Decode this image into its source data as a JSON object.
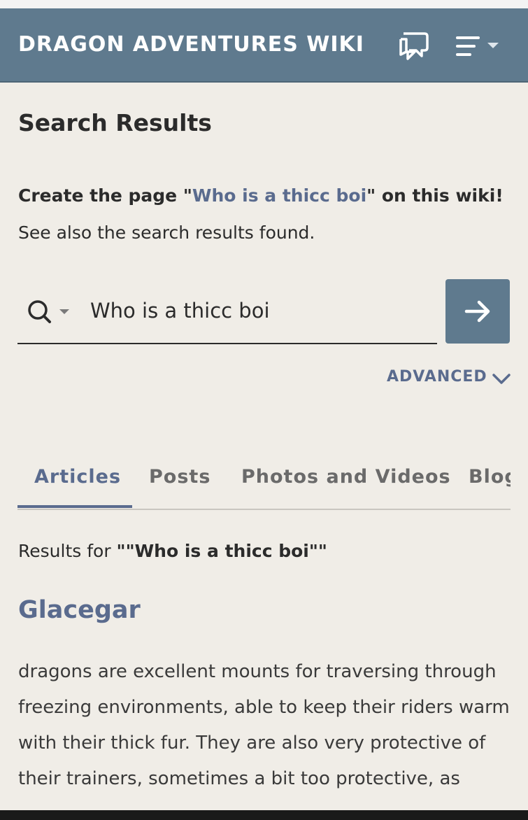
{
  "header": {
    "wiki_title": "DRAGON ADVENTURES WIKI",
    "discussions_icon": "speech-bubbles-icon",
    "menu_icon": "hamburger-menu-icon",
    "background_color": "#5f7a8e"
  },
  "main": {
    "page_title": "Search Results",
    "create_prefix": "Create the page \"",
    "create_link": "Who is a thicc boi",
    "create_suffix": "\" on this wiki!",
    "see_also": "See also the search results found."
  },
  "search": {
    "value": "Who is a thicc boi",
    "search_icon": "magnifier-icon",
    "go_icon": "arrow-right-icon",
    "advanced_label": "ADVANCED"
  },
  "tabs": [
    {
      "label": "Articles",
      "active": true
    },
    {
      "label": "Posts",
      "active": false
    },
    {
      "label": "Photos and Videos",
      "active": false
    },
    {
      "label": "Blogs",
      "active": false
    }
  ],
  "results": {
    "results_for_prefix": "Results for ",
    "results_for_query": "\"\"Who is a thicc boi\"\"",
    "items": [
      {
        "title": "Glacegar",
        "snippet": "dragons are excellent mounts for traversing through freezing environments, able to keep their riders warm with their thick fur. They are also very protective of their trainers, sometimes a bit too protective, as"
      }
    ]
  },
  "colors": {
    "accent": "#5a6b8e",
    "page_bg": "#f0ede7",
    "text": "#2b2b2b"
  }
}
